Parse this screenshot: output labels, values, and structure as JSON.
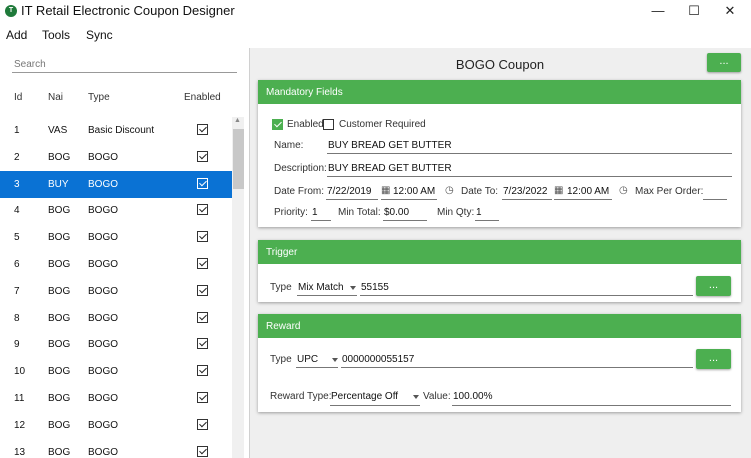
{
  "window": {
    "title": "IT Retail Electronic Coupon Designer",
    "icon_name": "app-logo-icon",
    "minimize": "—",
    "maximize": "☐",
    "close": "✕"
  },
  "menu": {
    "items": [
      "Add",
      "Tools",
      "Sync"
    ]
  },
  "left": {
    "search_placeholder": "Search",
    "columns": {
      "id": "Id",
      "name": "Nai",
      "type": "Type",
      "enabled": "Enabled"
    },
    "rows": [
      {
        "id": "1",
        "name": "VAS",
        "type": "Basic Discount",
        "enabled": true
      },
      {
        "id": "2",
        "name": "BOG",
        "type": "BOGO",
        "enabled": true
      },
      {
        "id": "3",
        "name": "BUY",
        "type": "BOGO",
        "enabled": true
      },
      {
        "id": "4",
        "name": "BOG",
        "type": "BOGO",
        "enabled": true
      },
      {
        "id": "5",
        "name": "BOG",
        "type": "BOGO",
        "enabled": true
      },
      {
        "id": "6",
        "name": "BOG",
        "type": "BOGO",
        "enabled": true
      },
      {
        "id": "7",
        "name": "BOG",
        "type": "BOGO",
        "enabled": true
      },
      {
        "id": "8",
        "name": "BOG",
        "type": "BOGO",
        "enabled": true
      },
      {
        "id": "9",
        "name": "BOG",
        "type": "BOGO",
        "enabled": true
      },
      {
        "id": "10",
        "name": "BOG",
        "type": "BOGO",
        "enabled": true
      },
      {
        "id": "11",
        "name": "BOG",
        "type": "BOGO",
        "enabled": true
      },
      {
        "id": "12",
        "name": "BOG",
        "type": "BOGO",
        "enabled": true
      },
      {
        "id": "13",
        "name": "BOG",
        "type": "BOGO",
        "enabled": true
      }
    ],
    "selected_row_id": "3"
  },
  "right": {
    "title": "BOGO Coupon",
    "top_button": "...",
    "mandatory": {
      "header": "Mandatory Fields",
      "enabled_label": "Enabled",
      "enabled": true,
      "customer_required_label": "Customer Required",
      "customer_required": false,
      "name_label": "Name:",
      "name_value": "BUY BREAD GET BUTTER",
      "description_label": "Description:",
      "description_value": "BUY BREAD GET BUTTER",
      "date_from_label": "Date From:",
      "date_from_value": "7/22/2019",
      "time_from_value": "12:00 AM",
      "date_to_label": "Date To:",
      "date_to_value": "7/23/2022",
      "time_to_value": "12:00 AM",
      "max_per_order_label": "Max Per Order:",
      "max_per_order_value": "",
      "priority_label": "Priority:",
      "priority_value": "1",
      "min_total_label": "Min Total:",
      "min_total_value": "$0.00",
      "min_qty_label": "Min Qty:",
      "min_qty_value": "1"
    },
    "trigger": {
      "header": "Trigger",
      "type_label": "Type",
      "type_value": "Mix Match",
      "code_value": "55155",
      "button": "..."
    },
    "reward": {
      "header": "Reward",
      "type_label": "Type",
      "type_value": "UPC",
      "code_value": "0000000055157",
      "button": "...",
      "reward_type_label": "Reward Type:",
      "reward_type_value": "Percentage Off",
      "value_label": "Value:",
      "value_value": "100.00%"
    }
  },
  "colors": {
    "accent_green": "#4caf50",
    "selection_blue": "#0a72d4"
  }
}
